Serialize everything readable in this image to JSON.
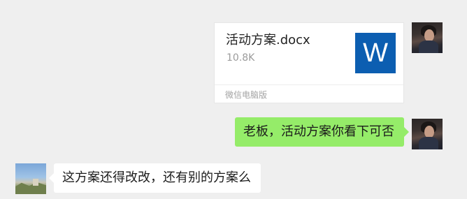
{
  "chat": {
    "messages": [
      {
        "sender": "me",
        "type": "file",
        "file_name": "活动方案.docx",
        "file_size": "10.8K",
        "source_label": "微信电脑版",
        "icon": "word-icon",
        "icon_letter": "W"
      },
      {
        "sender": "me",
        "type": "text",
        "text": "老板，活动方案你看下可否"
      },
      {
        "sender": "other",
        "type": "text",
        "text": "这方案还得改改，还有别的方案么"
      }
    ]
  },
  "colors": {
    "background": "#efefef",
    "my_bubble": "#95ec69",
    "other_bubble": "#ffffff",
    "word_icon": "#0c5eb1"
  }
}
